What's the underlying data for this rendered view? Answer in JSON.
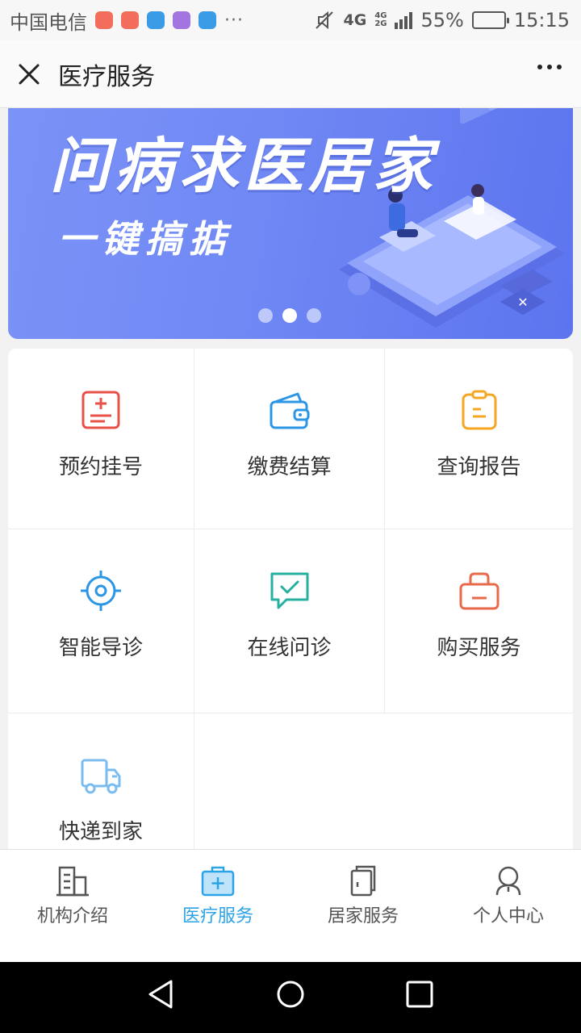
{
  "status_bar": {
    "carrier": "中国电信",
    "more_indicator": "···",
    "network_main": "4G",
    "network_secondary_top": "4G",
    "network_secondary_bottom": "2G",
    "battery_percent": "55%",
    "battery_level": 0.55,
    "time": "15:15",
    "notification_icons": [
      "mail-icon",
      "app-icon",
      "chat-icon",
      "photo-icon",
      "window-icon"
    ],
    "notification_colors": [
      "#f26d5b",
      "#f26d5b",
      "#3a9be6",
      "#a375e0",
      "#3a9be6"
    ]
  },
  "app_bar": {
    "title": "医疗服务",
    "close_icon": "close-icon",
    "more_icon": "more-dots-icon"
  },
  "banner": {
    "headline": "问病求医居家",
    "subline": "一键搞掂",
    "page_count": 3,
    "active_page": 2
  },
  "services": [
    {
      "label": "预约挂号",
      "icon": "appointment-icon",
      "color": "#e8504a"
    },
    {
      "label": "缴费结算",
      "icon": "wallet-icon",
      "color": "#2b95e6"
    },
    {
      "label": "查询报告",
      "icon": "clipboard-icon",
      "color": "#f5a623"
    },
    {
      "label": "智能导诊",
      "icon": "target-icon",
      "color": "#2b95e6"
    },
    {
      "label": "在线问诊",
      "icon": "chat-check-icon",
      "color": "#26b0a0"
    },
    {
      "label": "购买服务",
      "icon": "basket-icon",
      "color": "#e86a4a"
    },
    {
      "label": "快递到家",
      "icon": "truck-icon",
      "color": "#7bbcf0"
    }
  ],
  "tabs": [
    {
      "label": "机构介绍",
      "icon": "building-icon",
      "active": false
    },
    {
      "label": "医疗服务",
      "icon": "medical-kit-icon",
      "active": true
    },
    {
      "label": "居家服务",
      "icon": "home-service-icon",
      "active": false
    },
    {
      "label": "个人中心",
      "icon": "user-icon",
      "active": false
    }
  ],
  "colors": {
    "accent": "#2ba3e6",
    "banner": "#7088f4"
  }
}
